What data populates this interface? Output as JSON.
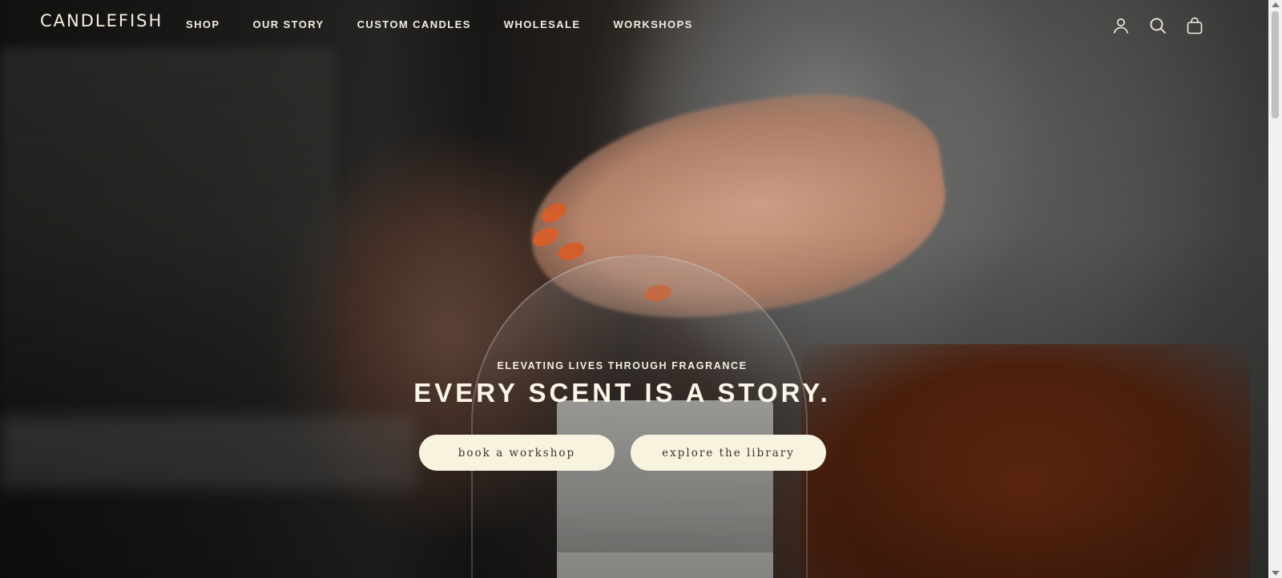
{
  "brand": {
    "logo_text": "CANDLEFISH"
  },
  "nav": {
    "items": [
      {
        "label": "SHOP"
      },
      {
        "label": "OUR STORY"
      },
      {
        "label": "CUSTOM CANDLES"
      },
      {
        "label": "WHOLESALE"
      },
      {
        "label": "WORKSHOPS"
      }
    ]
  },
  "header_icons": [
    {
      "name": "account-icon"
    },
    {
      "name": "search-icon"
    },
    {
      "name": "cart-icon"
    }
  ],
  "hero": {
    "eyebrow": "ELEVATING LIVES THROUGH FRAGRANCE",
    "headline": "EVERY SCENT IS A STORY.",
    "buttons": {
      "workshop_label": "book a workshop",
      "library_label": "explore the library"
    },
    "image_description_icon": "hero-photo"
  },
  "colors": {
    "button_bg": "#f8f3df",
    "text_light": "#f4efe1",
    "nail_accent": "#e2642e"
  }
}
